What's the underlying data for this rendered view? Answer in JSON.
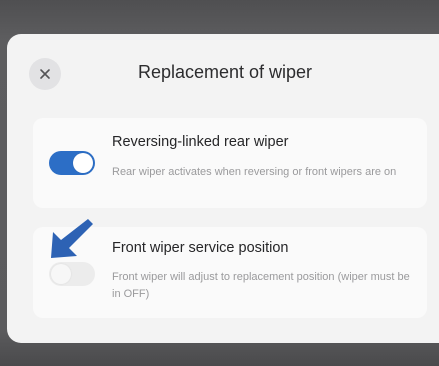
{
  "dialog": {
    "title": "Replacement of wiper",
    "close_icon": "close-icon"
  },
  "settings": [
    {
      "title": "Reversing-linked rear wiper",
      "description": "Rear wiper activates when reversing or front wipers are on",
      "enabled": true
    },
    {
      "title": "Front wiper service position",
      "description": "Front wiper will adjust to replacement position (wiper must be in OFF)",
      "enabled": false
    }
  ],
  "annotation": {
    "icon": "arrow-pointer-icon",
    "color": "#2d62b4"
  },
  "colors": {
    "toggle_on": "#2c6ec6",
    "toggle_off": "#ececec",
    "dialog_bg": "#f3f3f3",
    "card_bg": "#fafafa"
  }
}
